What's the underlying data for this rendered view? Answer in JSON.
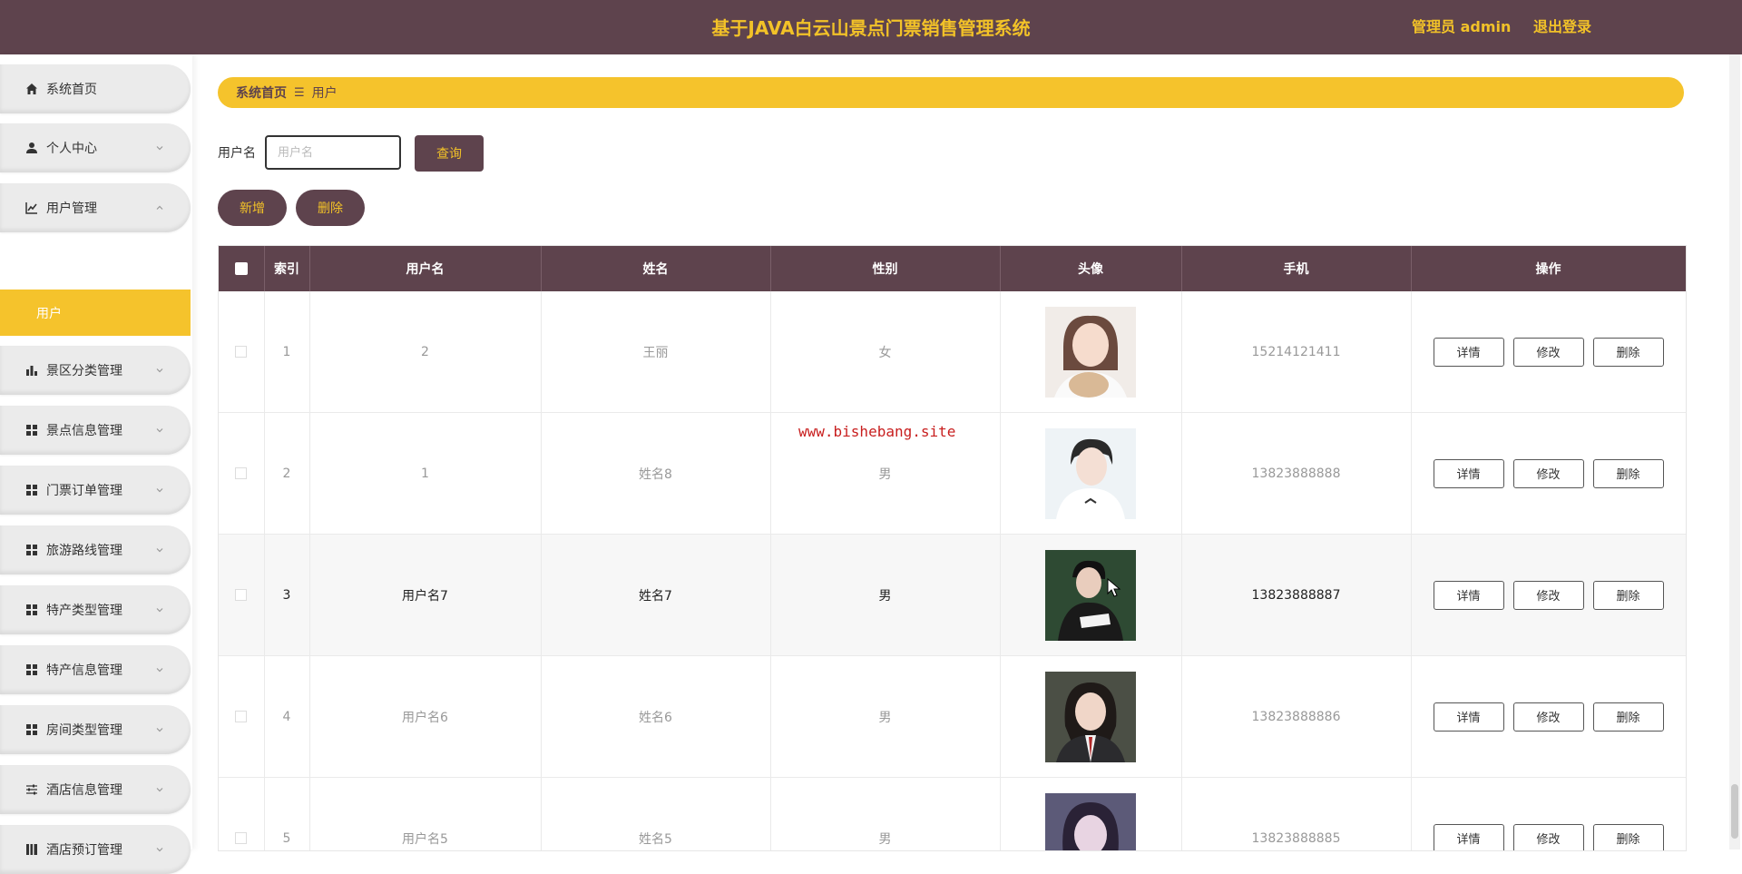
{
  "header": {
    "title": "基于JAVA白云山景点门票销售管理系统",
    "admin": "管理员 admin",
    "logout": "退出登录"
  },
  "sidebar": {
    "items": [
      {
        "label": "系统首页",
        "icon": "home-icon"
      },
      {
        "label": "个人中心",
        "icon": "user-icon"
      },
      {
        "label": "用户管理",
        "icon": "chart-line-icon",
        "expanded": true
      },
      {
        "label": "景区分类管理",
        "icon": "bar-chart-icon"
      },
      {
        "label": "景点信息管理",
        "icon": "grid-icon"
      },
      {
        "label": "门票订单管理",
        "icon": "grid-icon"
      },
      {
        "label": "旅游路线管理",
        "icon": "grid-icon"
      },
      {
        "label": "特产类型管理",
        "icon": "grid-icon"
      },
      {
        "label": "特产信息管理",
        "icon": "grid-icon"
      },
      {
        "label": "房间类型管理",
        "icon": "grid-icon"
      },
      {
        "label": "酒店信息管理",
        "icon": "sliders-icon"
      },
      {
        "label": "酒店预订管理",
        "icon": "book-icon"
      }
    ],
    "submenu": {
      "label": "用户"
    }
  },
  "breadcrumb": {
    "home": "系统首页",
    "sep": "☰",
    "current": "用户"
  },
  "search": {
    "label": "用户名",
    "placeholder": "用户名",
    "value": "",
    "query_label": "查询"
  },
  "actions": {
    "add_label": "新增",
    "delete_label": "删除"
  },
  "table": {
    "headers": [
      "",
      "索引",
      "用户名",
      "姓名",
      "性别",
      "头像",
      "手机",
      "操作"
    ],
    "rows": [
      {
        "index": "1",
        "username": "2",
        "name": "王丽",
        "gender": "女",
        "phone": "15214121411"
      },
      {
        "index": "2",
        "username": "1",
        "name": "姓名8",
        "gender": "男",
        "phone": "13823888888"
      },
      {
        "index": "3",
        "username": "用户名7",
        "name": "姓名7",
        "gender": "男",
        "phone": "13823888887"
      },
      {
        "index": "4",
        "username": "用户名6",
        "name": "姓名6",
        "gender": "男",
        "phone": "13823888886"
      },
      {
        "index": "5",
        "username": "用户名5",
        "name": "姓名5",
        "gender": "男",
        "phone": "13823888885"
      }
    ],
    "op_labels": {
      "detail": "详情",
      "edit": "修改",
      "delete": "删除"
    }
  },
  "watermark": "www.bishebang.site",
  "colors": {
    "header_bg": "#5e434d",
    "accent": "#f5c32c",
    "title_text": "#f2c228"
  }
}
